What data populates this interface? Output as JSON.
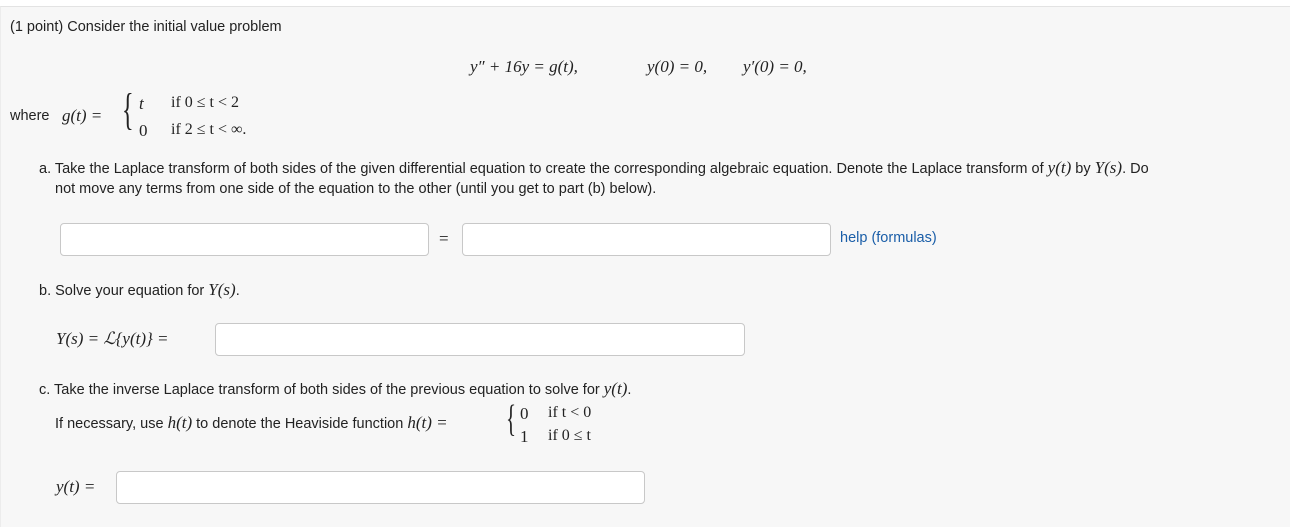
{
  "problem": {
    "intro": "(1 point) Consider the initial value problem",
    "ode_lhs": "y″ + 16y = g(t),",
    "ic1": "y(0) = 0,",
    "ic2": "y′(0) = 0,",
    "where_label": "where",
    "g_def": "g(t) =",
    "case1_value": "t",
    "case1_cond": "if 0 ≤ t < 2",
    "case2_value": "0",
    "case2_cond": "if 2 ≤ t < ∞."
  },
  "part_a": {
    "text_before": "a. Take the Laplace transform of both sides of the given differential equation to create the corresponding algebraic equation. Denote the Laplace transform of",
    "y_of_t": "y(t)",
    "by": "by",
    "Y_of_s": "Y(s)",
    "text_after": ". Do",
    "line2": "not move any terms from one side of the equation to the other (until you get to part (b) below).",
    "left_value": "",
    "equals": "=",
    "right_value": "",
    "help_link": "help (formulas)"
  },
  "part_b": {
    "text": "b. Solve your equation for",
    "Y_of_s": "Y(s)",
    "period": ".",
    "label": "Y(s) = ℒ{y(t)} =",
    "value": ""
  },
  "part_c": {
    "text": "c. Take the inverse Laplace transform of both sides of the previous equation to solve for",
    "y_of_t": "y(t)",
    "period": ".",
    "heaviside_text": "If necessary, use",
    "h_of_t": "h(t)",
    "heaviside_text2": "to denote the Heaviside function",
    "h_def": "h(t) =",
    "h_case1_value": "0",
    "h_case1_cond": "if t < 0",
    "h_case2_value": "1",
    "h_case2_cond": "if 0 ≤ t",
    "label": "y(t) =",
    "value": ""
  }
}
